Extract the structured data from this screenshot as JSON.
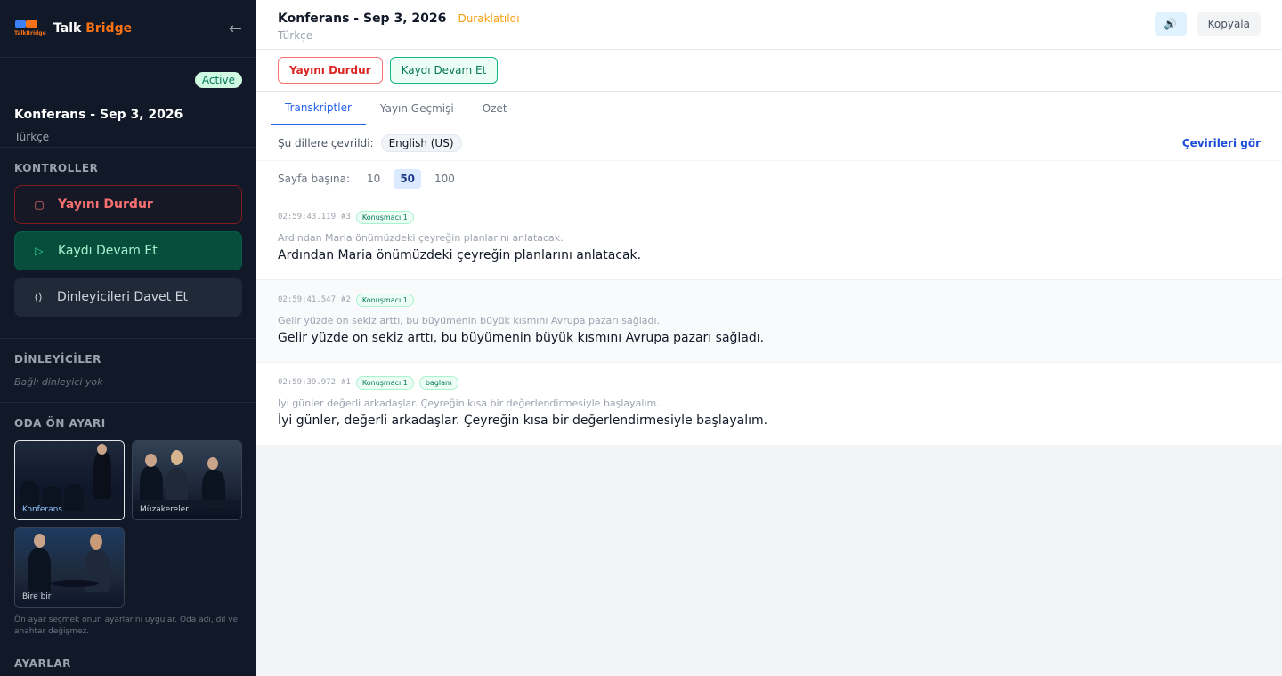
{
  "brand": {
    "name_part1": "Talk",
    "name_part2": "Bridge",
    "logo_text": "TalkBridge"
  },
  "room": {
    "badge": "Active",
    "title": "Konferans - Sep 3, 2026",
    "language": "Türkçe"
  },
  "controls": {
    "heading": "KONTROLLER",
    "stop": "Yayını Durdur",
    "resume": "Kaydı Devam Et",
    "invite": "Dinleyicileri Davet Et"
  },
  "listeners": {
    "heading": "DİNLEYİCİLER",
    "empty": "Bağlı dinleyici yok"
  },
  "presets": {
    "heading": "ODA ÖN AYARI",
    "items": [
      {
        "label": "Konferans",
        "selected": true
      },
      {
        "label": "Müzakereler",
        "selected": false
      },
      {
        "label": "Bire bir",
        "selected": false
      }
    ],
    "hint": "Ön ayar seçmek onun ayarlarını uygular. Oda adı, dil ve anahtar değişmez."
  },
  "settings": {
    "heading": "AYARLAR"
  },
  "topbar": {
    "title": "Konferans - Sep 3, 2026",
    "status": "Duraklatıldı",
    "language": "Türkçe",
    "speaker_icon": "🔊",
    "copy": "Kopyala"
  },
  "actions": {
    "stop": "Yayını Durdur",
    "resume": "Kaydı Devam Et"
  },
  "tabs": [
    "Transkriptler",
    "Yayın Geçmişi",
    "Ozet"
  ],
  "translations": {
    "label": "Şu dillere çevrildi:",
    "chip": "English (US)",
    "link": "Çevirileri gör"
  },
  "paging": {
    "label": "Sayfa başına:",
    "options": [
      "10",
      "50",
      "100"
    ],
    "selected": "50"
  },
  "entries": [
    {
      "ts": "02:59:43.119",
      "seq": "#3",
      "tags": [
        "Konuşmacı 1"
      ],
      "orig": "Ardından Maria önümüzdeki çeyreğin planlarını anlatacak.",
      "trans": "Ardından Maria önümüzdeki çeyreğin planlarını anlatacak."
    },
    {
      "ts": "02:59:41.547",
      "seq": "#2",
      "tags": [
        "Konuşmacı 1"
      ],
      "orig": "Gelir yüzde on sekiz arttı, bu büyümenin büyük kısmını Avrupa pazarı sağladı.",
      "trans": "Gelir yüzde on sekiz arttı, bu büyümenin büyük kısmını Avrupa pazarı sağladı."
    },
    {
      "ts": "02:59:39.972",
      "seq": "#1",
      "tags": [
        "Konuşmacı 1",
        "baglam"
      ],
      "orig": "İyi günler değerli arkadaşlar. Çeyreğin kısa bir değerlendirmesiyle başlayalım.",
      "trans": "İyi günler, değerli arkadaşlar. Çeyreğin kısa bir değerlendirmesiyle başlayalım."
    }
  ],
  "colors": {
    "accent": "#2563eb",
    "brand": "#f97316",
    "paused": "#f59e0b",
    "stop": "#dc2626",
    "resume": "#10b981"
  }
}
